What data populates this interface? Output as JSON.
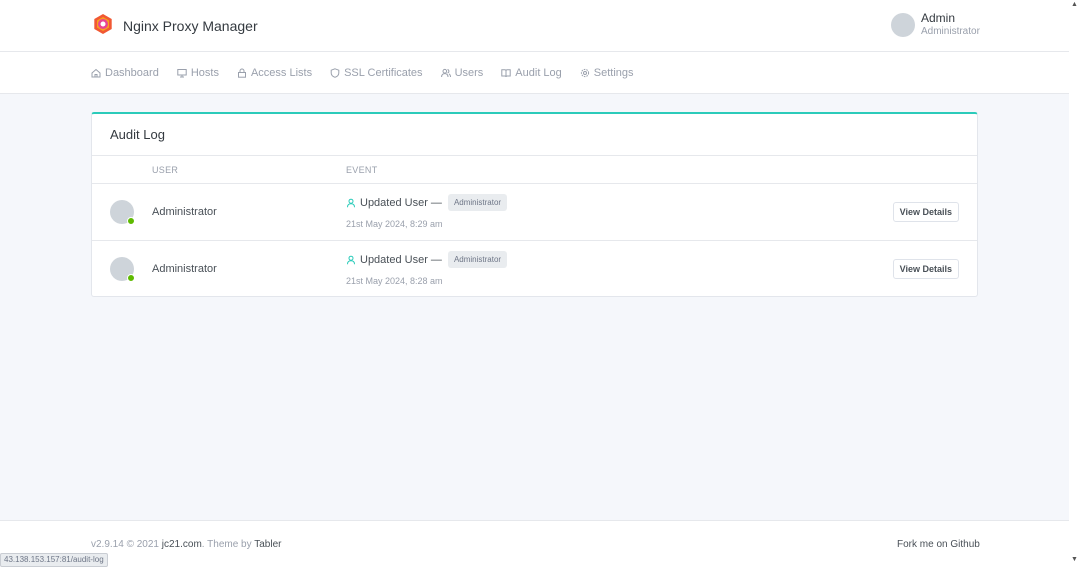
{
  "app": {
    "title": "Nginx Proxy Manager",
    "icon": "nginx-proxy-manager-logo"
  },
  "user_menu": {
    "name": "Admin",
    "role": "Administrator"
  },
  "nav": {
    "items": [
      {
        "label": "Dashboard",
        "icon": "home-icon"
      },
      {
        "label": "Hosts",
        "icon": "monitor-icon"
      },
      {
        "label": "Access Lists",
        "icon": "lock-icon"
      },
      {
        "label": "SSL Certificates",
        "icon": "shield-icon"
      },
      {
        "label": "Users",
        "icon": "users-icon"
      },
      {
        "label": "Audit Log",
        "icon": "book-icon"
      },
      {
        "label": "Settings",
        "icon": "settings-icon"
      }
    ]
  },
  "audit_log": {
    "title": "Audit Log",
    "columns": {
      "user": "USER",
      "event": "EVENT"
    },
    "rows": [
      {
        "user": "Administrator",
        "event": "Updated User —",
        "tag": "Administrator",
        "date": "21st May 2024, 8:29 am",
        "action": "View Details"
      },
      {
        "user": "Administrator",
        "event": "Updated User —",
        "tag": "Administrator",
        "date": "21st May 2024, 8:28 am",
        "action": "View Details"
      }
    ]
  },
  "footer": {
    "version": "v2.9.14 © 2021",
    "company": "jc21.com",
    "theme_prefix": ". Theme by",
    "theme": "Tabler",
    "fork": "Fork me on Github"
  },
  "status_bar": {
    "url": "43.138.153.157:81/audit-log"
  },
  "colors": {
    "accent": "#2bcbba",
    "online": "#5eba00",
    "background": "#f5f7fb"
  }
}
